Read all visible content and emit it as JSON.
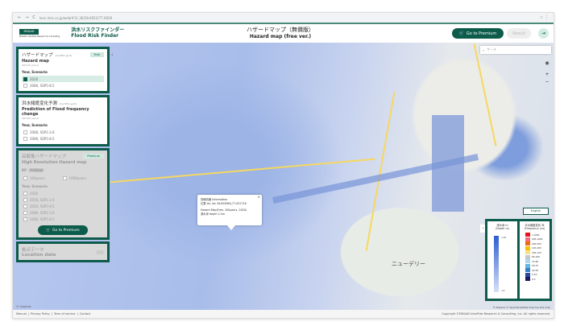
{
  "browser": {
    "url": "lanc.imic.co.jp/web/#11.36/28.6652/77.0839"
  },
  "header": {
    "logo": "MS&AD",
    "logo_sub": "MS&AD InterRisk Research & Consulting",
    "brand_jp": "洪水リスクファインダー",
    "brand_en": "Flood Risk Finder",
    "title_jp": "ハザードマップ（無償版）",
    "title_en": "Hazard map (free ver.)",
    "premium_label": "Go to Premium",
    "result_label": "Result"
  },
  "sidebar": {
    "hazard": {
      "title_jp": "ハザードマップ",
      "resolution": "(Ca.80m-grid)",
      "badge": "Free",
      "title_en": "Hazard map",
      "note": "(RP100 years)",
      "section": "Year, Scenario",
      "options": [
        {
          "label": "2020",
          "checked": true
        },
        {
          "label": "2080, SSP5-8.5",
          "checked": false
        }
      ]
    },
    "frequency": {
      "title_jp": "洪水頻度変化予測",
      "resolution": "(Ca.80m-grid)",
      "title_en": "Prediction of Flood frequency change",
      "note": "(RP100 years)",
      "section": "Year, Scenario",
      "options": [
        {
          "label": "2080, SSP1-2.6",
          "checked": false
        },
        {
          "label": "2080, SSP5-8.5",
          "checked": false
        }
      ]
    },
    "highres": {
      "title_jp": "高解像ハザードマップ",
      "badge": "Premium",
      "title_en": "High Resolution Hazard map",
      "rp_label": "RP（再現期間）",
      "rp_options": [
        "100years",
        "1000years"
      ],
      "section": "Year, Scenario",
      "options": [
        "2020",
        "2050, SSP1-2.6",
        "2050, SSP5-8.5",
        "2080, SSP1-2.6",
        "2080, SSP5-8.5"
      ],
      "premium_label": "Go to Premium"
    },
    "location": {
      "title_jp": "拠点データ",
      "title_en": "Location data"
    }
  },
  "map": {
    "search_placeholder": "サーチ",
    "city_label": "ニューデリー",
    "english_label": "English",
    "popup": {
      "line1": "詳細情報 Information",
      "line2": "位置 lat, lon 28.628984,77.032718",
      "line3": "Hazard Map(Free, 100years, 2020)",
      "line4": "浸水深 depth 2.5m"
    },
    "attribution": "© Mapbox © OpenStreetMap Improve this map",
    "mapbox": "mapbox"
  },
  "legend": {
    "depth_title_jp": "浸水深 m",
    "depth_title_en": "(Depth m)",
    "depth_max": ">10",
    "depth_min": "<0",
    "freq_title_jp": "洪水頻度変化 年",
    "freq_title_en": "(Frequency yrs)",
    "freq": [
      {
        "label": ">1000",
        "color": "#e8141c"
      },
      {
        "label": "500-1000",
        "color": "#f07080"
      },
      {
        "label": "200-500",
        "color": "#f06a10"
      },
      {
        "label": "120-200",
        "color": "#fbc000"
      },
      {
        "label": "100-120",
        "color": "#f6e08a"
      },
      {
        "label": "80-100",
        "color": "#c8c8c8"
      },
      {
        "label": "75-80",
        "color": "#a8d8f0"
      },
      {
        "label": "50-75",
        "color": "#60b8e0"
      },
      {
        "label": "20-50",
        "color": "#3a80c8"
      },
      {
        "label": "5-20",
        "color": "#2a4aa0"
      },
      {
        "label": "0-5",
        "color": "#1a1a60"
      }
    ]
  },
  "footer": {
    "links": [
      "Manual",
      "Privacy Policy",
      "Term of service",
      "Contact"
    ],
    "copyright": "Copyright ©MS&AD InterRisk Research & Consulting, Inc. All rights reserved."
  }
}
